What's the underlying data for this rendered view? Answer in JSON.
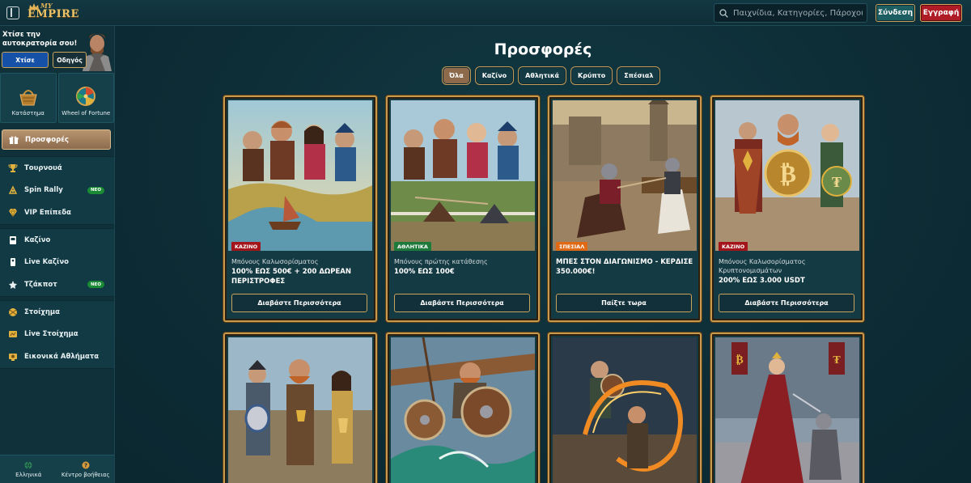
{
  "colors": {
    "accent_gold": "#c89a4d",
    "register_red": "#b01c25",
    "login_teal": "#1d5e63",
    "badge_casino": "#a3141b",
    "badge_sports": "#1e7a3a",
    "badge_special": "#e06a14",
    "badge_new": "#1a8a35"
  },
  "topbar": {
    "menu_icon": "sidebar-toggle-icon",
    "logo_my": "MY",
    "logo_main": "EMPIRE",
    "search_placeholder": "Παιχνίδια, Κατηγορίες, Πάροχοι",
    "login_label": "Σύνδεση",
    "register_label": "Εγγραφή"
  },
  "sidebar": {
    "promo_text": "Χτίσε την αυτοκρατορία σου!",
    "build_label": "Χτίσε",
    "guide_label": "Οδηγός",
    "tiles": [
      {
        "label": "Κατάστημα",
        "icon": "basket-icon"
      },
      {
        "label": "Wheel of Fortune",
        "icon": "wheel-icon"
      }
    ],
    "active_item": {
      "label": "Προσφορές",
      "icon": "gift-icon"
    },
    "groups": [
      [
        {
          "label": "Τουρνουά",
          "icon": "trophy-icon",
          "badge": ""
        },
        {
          "label": "Spin Rally",
          "icon": "spin-icon",
          "badge": "ΝΕΟ"
        },
        {
          "label": "VIP Επίπεδα",
          "icon": "diamond-icon",
          "badge": ""
        }
      ],
      [
        {
          "label": "Καζίνο",
          "icon": "slot-icon",
          "badge": ""
        },
        {
          "label": "Live Καζίνο",
          "icon": "live-casino-icon",
          "badge": ""
        },
        {
          "label": "Τζάκποτ",
          "icon": "jackpot-icon",
          "badge": "ΝΕΟ"
        }
      ],
      [
        {
          "label": "Στοίχημα",
          "icon": "ball-icon",
          "badge": ""
        },
        {
          "label": "Live Στοίχημα",
          "icon": "live-bet-icon",
          "badge": ""
        },
        {
          "label": "Εικονικά Αθλήματα",
          "icon": "virtual-sports-icon",
          "badge": ""
        }
      ]
    ],
    "footer": [
      {
        "label": "Ελληνικά",
        "icon": "globe-icon"
      },
      {
        "label": "Κέντρο βοήθειας",
        "icon": "help-icon"
      }
    ]
  },
  "main": {
    "title": "Προσφορές",
    "filters": [
      "Όλα",
      "Καζίνο",
      "Αθλητικά",
      "Κρύπτο",
      "Σπέσιαλ"
    ],
    "active_filter": "Όλα",
    "cards": [
      {
        "category": "ΚΑΖΙΝΟ",
        "category_color": "#a3141b",
        "subtitle": "Μπόνους Καλωσορίσματος",
        "title": "100% ΕΩΣ 500€ + 200 ΔΩΡΕΑΝ ΠΕΡΙΣΤΡΟΦΕΣ",
        "button": "Διαβάστε Περισσότερα",
        "image": "heroes-harbor-art"
      },
      {
        "category": "ΑΘΛΗΤΙΚΑ",
        "category_color": "#1e7a3a",
        "subtitle": "Μπόνους πρώτης κατάθεσης",
        "title": "100% ΕΩΣ 100€",
        "button": "Διαβάστε Περισσότερα",
        "image": "heroes-joust-art"
      },
      {
        "category": "ΣΠΕΣΙΑΛ",
        "category_color": "#e06a14",
        "subtitle": "",
        "title": "ΜΠΕΣ ΣΤΟΝ ΔΙΑΓΩΝΙΣΜΟ - ΚΕΡΔΙΣΕ 350.000€!",
        "button": "Παίξτε τωρα",
        "image": "knights-joust-art"
      },
      {
        "category": "ΚΑΖΙΝΟ",
        "category_color": "#a3141b",
        "subtitle": "Μπόνους Καλωσορίσματος Κρυπτονομισμάτων",
        "title": "200% ΕΩΣ 3.000 USDT",
        "button": "Διαβάστε Περισσότερα",
        "image": "crypto-warriors-art"
      },
      {
        "category": "",
        "category_color": "",
        "subtitle": "",
        "title": "",
        "button": "",
        "image": "heroes-trophies-art"
      },
      {
        "category": "",
        "category_color": "",
        "subtitle": "",
        "title": "",
        "button": "",
        "image": "viking-shields-art"
      },
      {
        "category": "",
        "category_color": "",
        "subtitle": "",
        "title": "",
        "button": "",
        "image": "fire-warriors-art"
      },
      {
        "category": "",
        "category_color": "",
        "subtitle": "",
        "title": "",
        "button": "",
        "image": "queen-knight-art"
      }
    ]
  }
}
